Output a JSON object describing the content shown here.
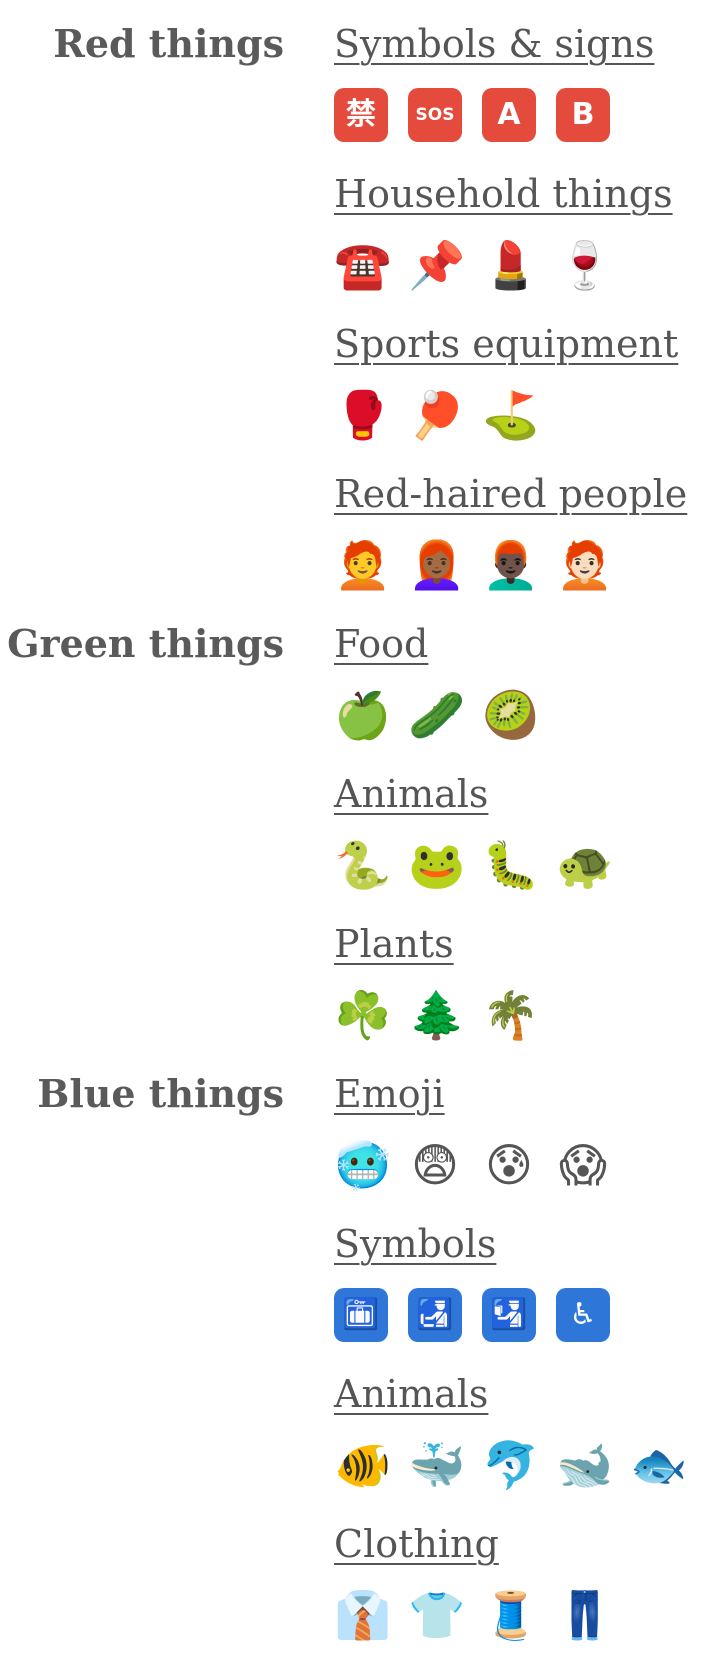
{
  "groups": [
    {
      "label": "Red things",
      "categories": [
        {
          "title": "Symbols & signs",
          "emoji": [
            {
              "char": "禁",
              "icon": "prohibited-ideograph-icon",
              "tile": "red"
            },
            {
              "char": "SOS",
              "icon": "sos-button-icon",
              "tile": "red",
              "small": true
            },
            {
              "char": "A",
              "icon": "a-blood-type-icon",
              "tile": "red"
            },
            {
              "char": "B",
              "icon": "b-blood-type-icon",
              "tile": "red"
            }
          ]
        },
        {
          "title": "Household things",
          "emoji": [
            {
              "char": "☎️",
              "icon": "telephone-icon"
            },
            {
              "char": "📌",
              "icon": "pushpin-icon"
            },
            {
              "char": "💄",
              "icon": "lipstick-icon"
            },
            {
              "char": "🍷",
              "icon": "wine-glass-icon"
            }
          ]
        },
        {
          "title": "Sports equipment",
          "emoji": [
            {
              "char": "🥊",
              "icon": "boxing-glove-icon"
            },
            {
              "char": "🏓",
              "icon": "ping-pong-icon"
            },
            {
              "char": "⛳",
              "icon": "golf-flag-icon"
            }
          ]
        },
        {
          "title": "Red-haired people",
          "emoji": [
            {
              "char": "🧑‍🦰",
              "icon": "red-haired-person-icon"
            },
            {
              "char": "👩🏾‍🦰",
              "icon": "red-haired-woman-icon"
            },
            {
              "char": "👨🏿‍🦰",
              "icon": "red-haired-man-icon"
            },
            {
              "char": "🧑🏻‍🦰",
              "icon": "red-haired-person-light-icon"
            }
          ]
        }
      ]
    },
    {
      "label": "Green things",
      "categories": [
        {
          "title": "Food",
          "emoji": [
            {
              "char": "🍏",
              "icon": "green-apple-icon"
            },
            {
              "char": "🥒",
              "icon": "cucumber-icon"
            },
            {
              "char": "🥝",
              "icon": "kiwi-icon"
            }
          ]
        },
        {
          "title": "Animals",
          "emoji": [
            {
              "char": "🐍",
              "icon": "snake-icon"
            },
            {
              "char": "🐸",
              "icon": "frog-icon"
            },
            {
              "char": "🐛",
              "icon": "caterpillar-icon"
            },
            {
              "char": "🐢",
              "icon": "turtle-icon"
            }
          ]
        },
        {
          "title": "Plants",
          "emoji": [
            {
              "char": "☘️",
              "icon": "shamrock-icon"
            },
            {
              "char": "🌲",
              "icon": "evergreen-tree-icon"
            },
            {
              "char": "🌴",
              "icon": "palm-tree-icon"
            }
          ]
        }
      ]
    },
    {
      "label": "Blue things",
      "categories": [
        {
          "title": "Emoji",
          "emoji": [
            {
              "char": "🥶",
              "icon": "cold-face-icon"
            },
            {
              "char": "😨",
              "icon": "fearful-face-icon"
            },
            {
              "char": "😰",
              "icon": "anxious-face-icon"
            },
            {
              "char": "😱",
              "icon": "screaming-face-icon"
            }
          ]
        },
        {
          "title": "Symbols",
          "emoji": [
            {
              "char": "🛅",
              "icon": "left-luggage-icon",
              "tile": "blue"
            },
            {
              "char": "🛃",
              "icon": "customs-icon",
              "tile": "blue"
            },
            {
              "char": "🛂",
              "icon": "passport-control-icon",
              "tile": "blue"
            },
            {
              "char": "♿",
              "icon": "wheelchair-icon",
              "tile": "blue"
            }
          ]
        },
        {
          "title": "Animals",
          "emoji": [
            {
              "char": "🐠",
              "icon": "tropical-fish-icon"
            },
            {
              "char": "🐳",
              "icon": "spouting-whale-icon"
            },
            {
              "char": "🐬",
              "icon": "dolphin-icon"
            },
            {
              "char": "🐋",
              "icon": "whale-icon"
            },
            {
              "char": "🐟",
              "icon": "fish-icon"
            }
          ]
        },
        {
          "title": "Clothing",
          "emoji": [
            {
              "char": "👔",
              "icon": "necktie-shirt-icon"
            },
            {
              "char": "👕",
              "icon": "t-shirt-icon"
            },
            {
              "char": "🧵",
              "icon": "thread-spool-icon"
            },
            {
              "char": "👖",
              "icon": "jeans-icon"
            }
          ]
        }
      ]
    }
  ]
}
